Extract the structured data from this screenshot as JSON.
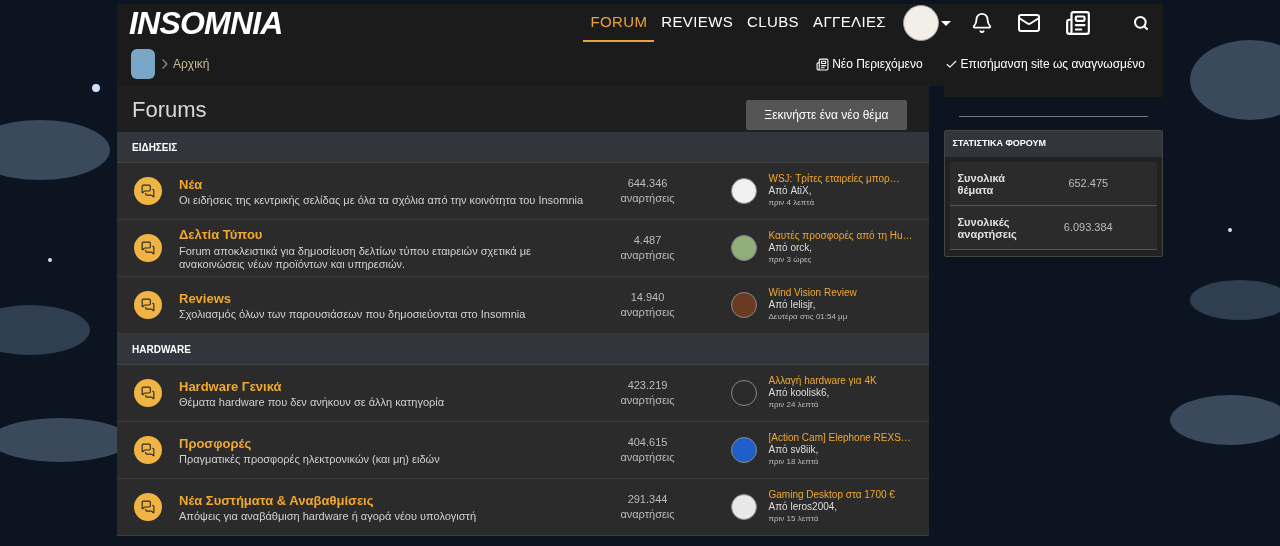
{
  "logo": "INSOMNIA",
  "nav": [
    {
      "label": "FORUM",
      "selected": true
    },
    {
      "label": "REVIEWS",
      "selected": false
    },
    {
      "label": "CLUBS",
      "selected": false
    },
    {
      "label": "ΑΓΓΕΛΙΕΣ",
      "selected": false
    }
  ],
  "breadcrumb": "Αρχική",
  "actions": [
    {
      "kind": "news",
      "label": "Νέο Περιεχόμενο"
    },
    {
      "kind": "check",
      "label": "Επισήμανση site ως αναγνωσμένο"
    }
  ],
  "page_title": "Forums",
  "new_thread_button": "Ξεκινήστε ένα νέο θέμα",
  "sections": [
    {
      "title": "ΕΙΔΗΣΕΙΣ",
      "forums": [
        {
          "name": "Νέα",
          "description": "Οι ειδήσεις της κεντρικής σελίδας με όλα τα σχόλια από την κοινότητα του Insomnia",
          "count": "644.346",
          "count_label": "αναρτήσεις",
          "last_title": "WSJ: Τρίτες εταιρείες μπορ…",
          "last_by": "Από AtiX,",
          "last_time": "πριν 4 λεπτά",
          "color": "#f0f0f0"
        },
        {
          "name": "Δελτία Τύπου",
          "description": "Forum αποκλειστικά για δημοσίευση δελτίων τύπου εταιρειών σχετικά με ανακοινώσεις νέων προϊόντων και υπηρεσιών.",
          "count": "4.487",
          "count_label": "αναρτήσεις",
          "last_title": "Καυτές προσφορές από τη Hu…",
          "last_by": "Από orck,",
          "last_time": "πριν 3 ώρες",
          "color": "#8fae7a"
        },
        {
          "name": "Reviews",
          "description": "Σχολιασμός όλων των παρουσιάσεων που δημοσιεύονται στο Insomnia",
          "count": "14.940",
          "count_label": "αναρτήσεις",
          "last_title": "Wind Vision Review",
          "last_by": "Από lelisjr,",
          "last_time": "Δευτέρα στις 01:54 μμ",
          "color": "#6b3a22"
        }
      ]
    },
    {
      "title": "HARDWARE",
      "forums": [
        {
          "name": "Hardware Γενικά",
          "description": "Θέματα hardware που δεν ανήκουν σε άλλη κατηγορία",
          "count": "423.219",
          "count_label": "αναρτήσεις",
          "last_title": "Αλλαγή hardware για 4K",
          "last_by": "Από koolisk6,",
          "last_time": "πριν 24 λεπτά",
          "color": "#2a2a2a"
        },
        {
          "name": "Προσφορές",
          "description": "Πραγματικές προσφορές ηλεκτρονικών (και μη) ειδών",
          "count": "404.615",
          "count_label": "αναρτήσεις",
          "last_title": "[Action Cam] Elephone REXS…",
          "last_by": "Από sv8iik,",
          "last_time": "πριν 18 λεπτά",
          "color": "#1e5fc8"
        },
        {
          "name": "Νέα Συστήματα & Αναβαθμίσεις",
          "description": "Απόψεις για αναβάθμιση hardware ή αγορά νέου υπολογιστή",
          "count": "291.344",
          "count_label": "αναρτήσεις",
          "last_title": "Gaming Desktop στα 1700 €",
          "last_by": "Από leros2004,",
          "last_time": "πριν 15 λεπτά",
          "color": "#e8e8e8"
        }
      ]
    }
  ],
  "stats": {
    "title": "ΣΤΑΤΙΣΤΙΚΑ ΦΟΡΟΥΜ",
    "rows": [
      {
        "label": "Συνολικά θέματα",
        "value": "652.475"
      },
      {
        "label": "Συνολικές αναρτήσεις",
        "value": "6.093.384"
      }
    ]
  }
}
